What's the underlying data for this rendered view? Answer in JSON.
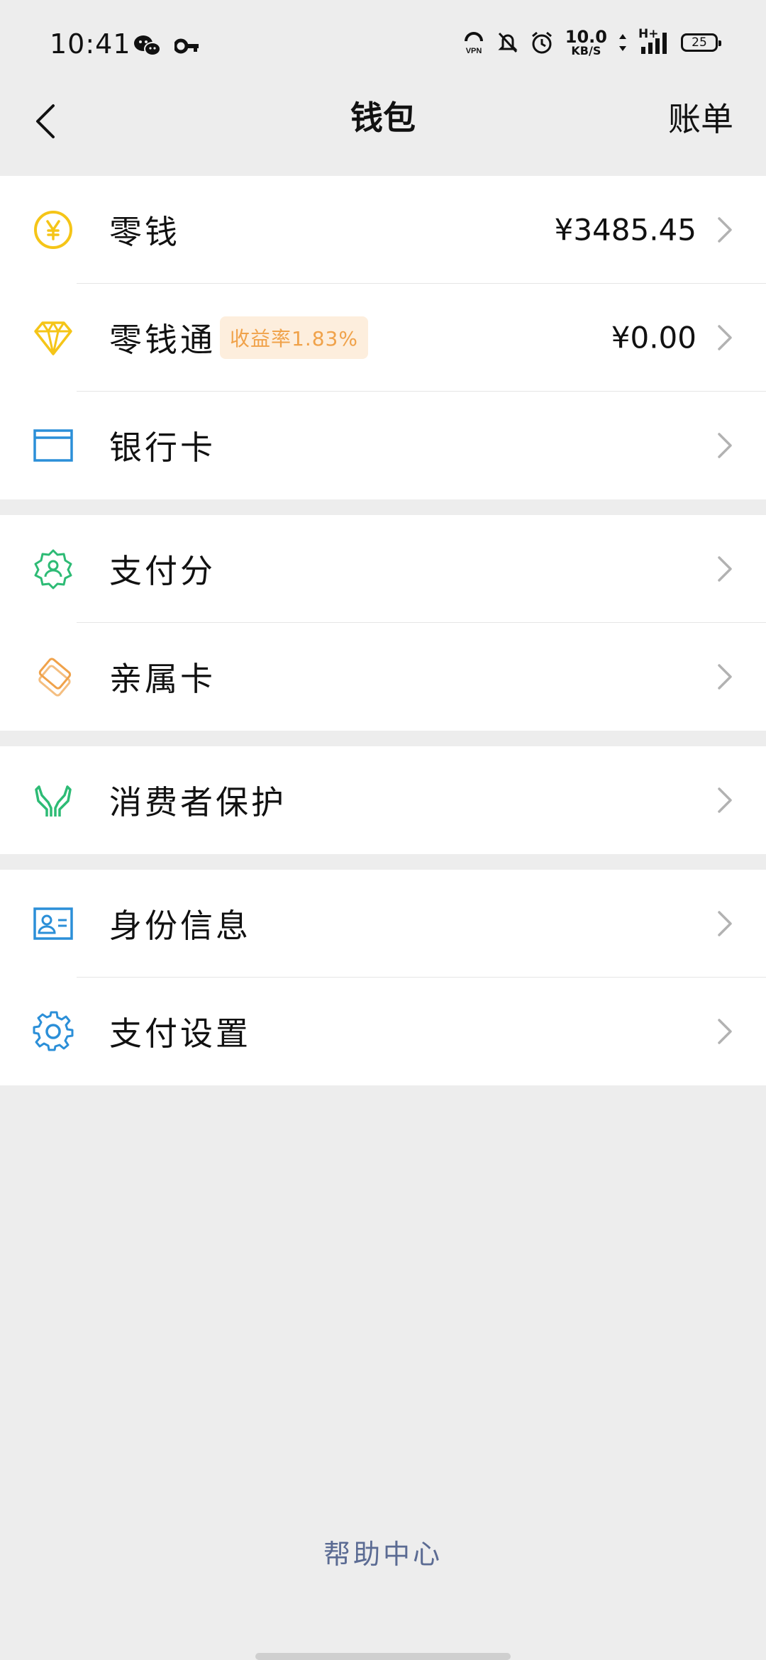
{
  "status_bar": {
    "time": "10:41",
    "net_speed_value": "10.0",
    "net_speed_unit": "KB/S",
    "network_type": "H+",
    "battery": "25"
  },
  "nav": {
    "title": "钱包",
    "right_action": "账单"
  },
  "groups": [
    {
      "rows": [
        {
          "label": "零钱",
          "value": "¥3485.45",
          "icon": "yuan-coin-icon",
          "icon_color": "#f5c518"
        },
        {
          "label": "零钱通",
          "badge": "收益率1.83%",
          "value": "¥0.00",
          "icon": "diamond-icon",
          "icon_color": "#f5c518"
        },
        {
          "label": "银行卡",
          "icon": "bank-card-icon",
          "icon_color": "#2b8fd8"
        }
      ]
    },
    {
      "rows": [
        {
          "label": "支付分",
          "icon": "badge-user-icon",
          "icon_color": "#2dbb75"
        },
        {
          "label": "亲属卡",
          "icon": "family-card-icon",
          "icon_color": "#f0a24a"
        }
      ]
    },
    {
      "rows": [
        {
          "label": "消费者保护",
          "icon": "protect-hands-icon",
          "icon_color": "#2dbb75"
        }
      ]
    },
    {
      "rows": [
        {
          "label": "身份信息",
          "icon": "id-card-icon",
          "icon_color": "#2b8fd8"
        },
        {
          "label": "支付设置",
          "icon": "gear-icon",
          "icon_color": "#2b8fd8"
        }
      ]
    }
  ],
  "footer": {
    "help_center": "帮助中心"
  }
}
